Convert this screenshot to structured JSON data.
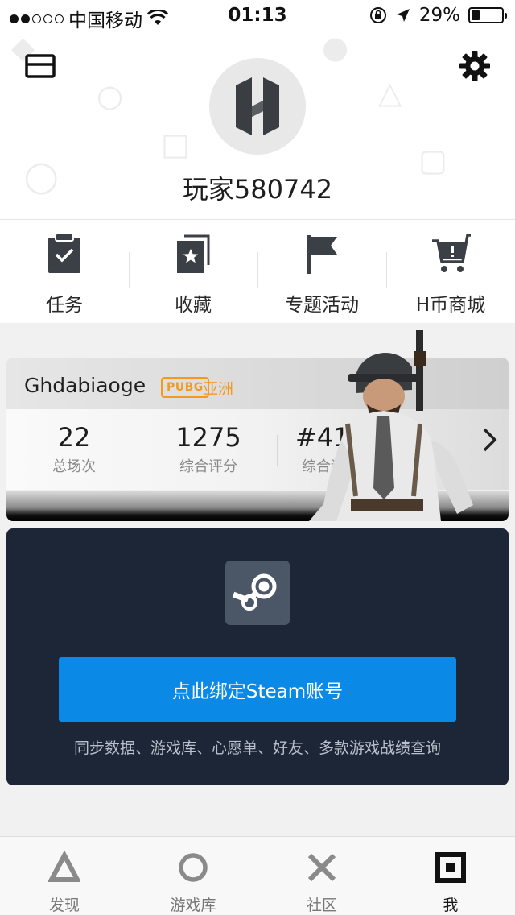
{
  "status_bar": {
    "carrier": "中国移动",
    "time": "01:13",
    "battery_percent": "29%",
    "battery_level": 0.29,
    "signal_bars_filled": 2,
    "signal_bars_total": 5
  },
  "profile": {
    "username": "玩家580742",
    "avatar_icon": "h-logo-icon",
    "mail_icon": "mail-icon",
    "settings_icon": "gear-icon"
  },
  "quick_menu": [
    {
      "label": "任务",
      "icon": "clipboard-check-icon"
    },
    {
      "label": "收藏",
      "icon": "bookmark-star-icon"
    },
    {
      "label": "专题活动",
      "icon": "flag-icon"
    },
    {
      "label": "H币商城",
      "icon": "shopping-cart-icon"
    }
  ],
  "pubg_card": {
    "player_name": "Ghdabiaoge",
    "game_badge": "PUBG",
    "region": "亚洲",
    "stats": [
      {
        "value": "22",
        "label": "总场次"
      },
      {
        "value": "1275",
        "label": "综合评分"
      },
      {
        "value": "#41.8w",
        "label": "综合评分排名"
      }
    ]
  },
  "steam_card": {
    "bind_button_label": "点此绑定Steam账号",
    "description": "同步数据、游戏库、心愿单、好友、多款游戏战绩查询"
  },
  "tab_bar": [
    {
      "label": "发现",
      "icon": "triangle-icon",
      "active": false
    },
    {
      "label": "游戏库",
      "icon": "circle-icon",
      "active": false
    },
    {
      "label": "社区",
      "icon": "cross-icon",
      "active": false
    },
    {
      "label": "我",
      "icon": "square-icon",
      "active": true
    }
  ],
  "colors": {
    "accent_blue": "#0a8ae6",
    "steam_card_bg": "#1c2636",
    "pubg_orange": "#f29a1e"
  }
}
